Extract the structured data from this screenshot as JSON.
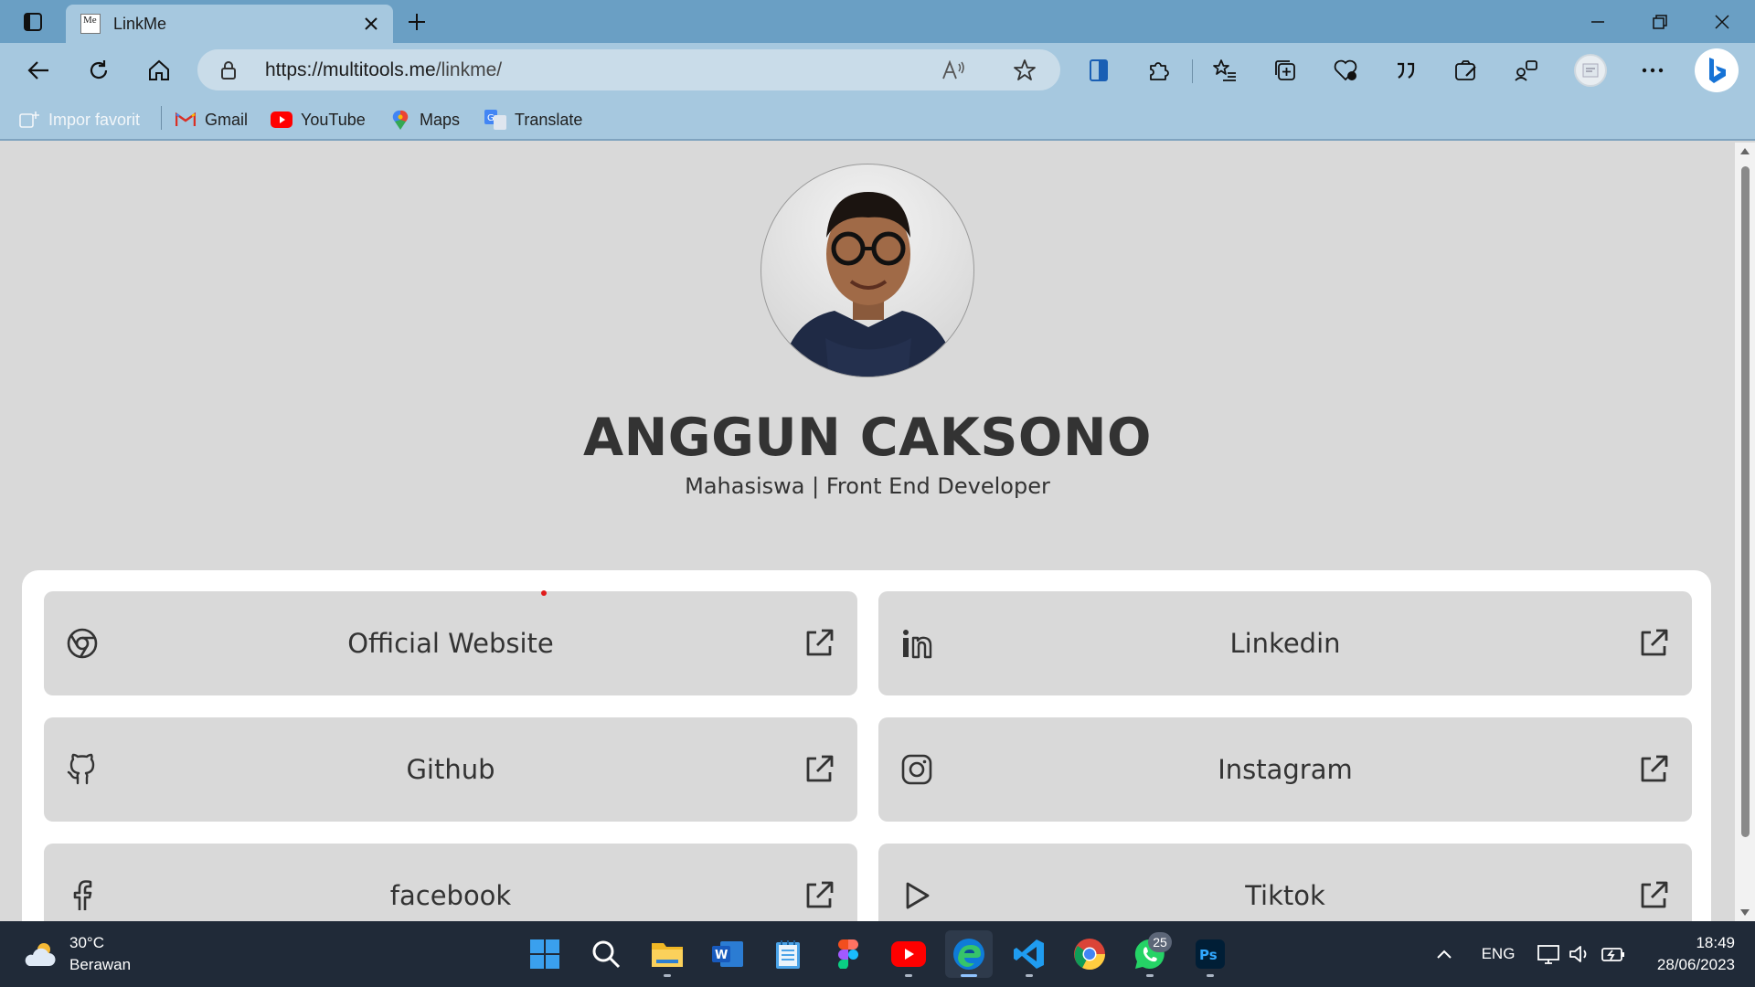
{
  "browser": {
    "tab_title": "LinkMe",
    "tab_favicon_text": "Me",
    "url_domain": "https://multitools.me",
    "url_path": "/linkme/"
  },
  "bookmarks": [
    {
      "label": "Impor favorit",
      "icon": "import-favorites-icon"
    },
    {
      "label": "Gmail",
      "icon": "gmail-icon"
    },
    {
      "label": "YouTube",
      "icon": "youtube-icon"
    },
    {
      "label": "Maps",
      "icon": "maps-icon"
    },
    {
      "label": "Translate",
      "icon": "translate-icon"
    }
  ],
  "profile": {
    "name": "ANGGUN CAKSONO",
    "role": "Mahasiswa | Front End Developer"
  },
  "links": [
    {
      "label": "Official Website",
      "icon": "chrome-icon"
    },
    {
      "label": "Linkedin",
      "icon": "linkedin-icon"
    },
    {
      "label": "Github",
      "icon": "github-icon"
    },
    {
      "label": "Instagram",
      "icon": "instagram-icon"
    },
    {
      "label": "facebook",
      "icon": "facebook-icon"
    },
    {
      "label": "Tiktok",
      "icon": "play-icon"
    }
  ],
  "taskbar": {
    "weather_temp": "30°C",
    "weather_desc": "Berawan",
    "whatsapp_badge": "25",
    "language": "ENG",
    "time": "18:49",
    "date": "28/06/2023"
  },
  "colors": {
    "titlebar": "#6a9fc4",
    "toolbar": "#a6c8df",
    "page_bg": "#d9d9d9",
    "card_bg": "#ffffff",
    "text": "#333333",
    "taskbar": "#202a38"
  }
}
